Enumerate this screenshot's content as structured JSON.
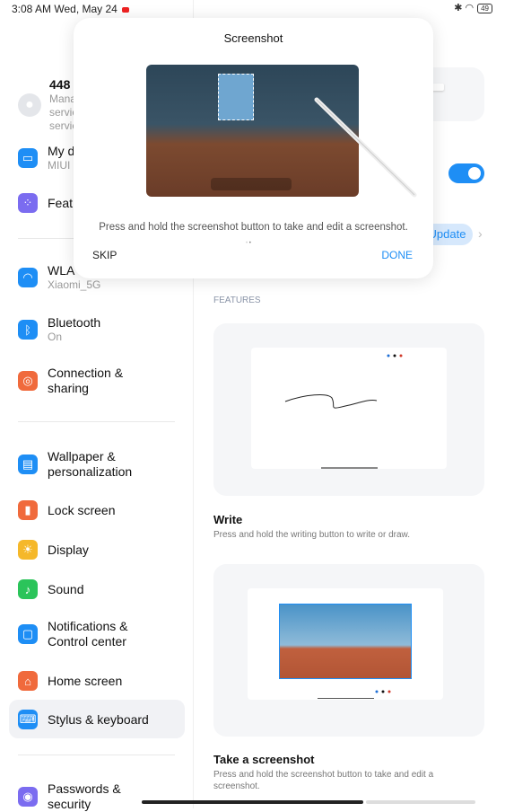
{
  "status": {
    "time": "3:08 AM Wed, May 24",
    "battery": "49"
  },
  "sidebar": {
    "account": {
      "name": "448",
      "lines": [
        "Manag",
        "servic",
        "servic"
      ]
    },
    "items": [
      {
        "label": "My d",
        "sub": "MIUI",
        "icon": "device-icon",
        "color": "#1e8ef5"
      },
      {
        "label": "Feat",
        "icon": "grid-icon",
        "color": "#7b6cf0"
      },
      {
        "label": "WLA",
        "sub": "Xiaomi_5G",
        "icon": "wifi-icon",
        "color": "#1e8ef5"
      },
      {
        "label": "Bluetooth",
        "sub": "On",
        "icon": "bluetooth-icon",
        "color": "#1e8ef5"
      },
      {
        "label": "Connection &\nsharing",
        "icon": "connection-icon",
        "color": "#f06a3c"
      },
      {
        "label": "Wallpaper &\npersonalization",
        "icon": "wallpaper-icon",
        "color": "#1e8ef5"
      },
      {
        "label": "Lock screen",
        "icon": "lock-icon",
        "color": "#f06a3c"
      },
      {
        "label": "Display",
        "icon": "sun-icon",
        "color": "#f5b82a"
      },
      {
        "label": "Sound",
        "icon": "sound-icon",
        "color": "#2bc45a"
      },
      {
        "label": "Notifications &\nControl center",
        "icon": "notification-icon",
        "color": "#1e8ef5"
      },
      {
        "label": "Home screen",
        "icon": "home-icon",
        "color": "#f06a3c"
      },
      {
        "label": "Stylus & keyboard",
        "icon": "keyboard-icon",
        "color": "#1e8ef5"
      },
      {
        "label": "Passwords &\nsecurity",
        "icon": "fingerprint-icon",
        "color": "#7b6cf0"
      }
    ]
  },
  "main": {
    "update_label": "Update",
    "toggle_on": true,
    "features_header": "FEATURES",
    "write": {
      "title": "Write",
      "desc": "Press and hold the writing button to write or draw."
    },
    "screenshot": {
      "title": "Take a screenshot",
      "desc": "Press and hold the screenshot button to take and edit a screenshot."
    }
  },
  "modal": {
    "title": "Screenshot",
    "desc": "Press and hold the screenshot button to take and edit a screenshot.",
    "skip": "SKIP",
    "done": "DONE",
    "page": 2,
    "pages": 2,
    "accent": "#1e8ef5"
  }
}
